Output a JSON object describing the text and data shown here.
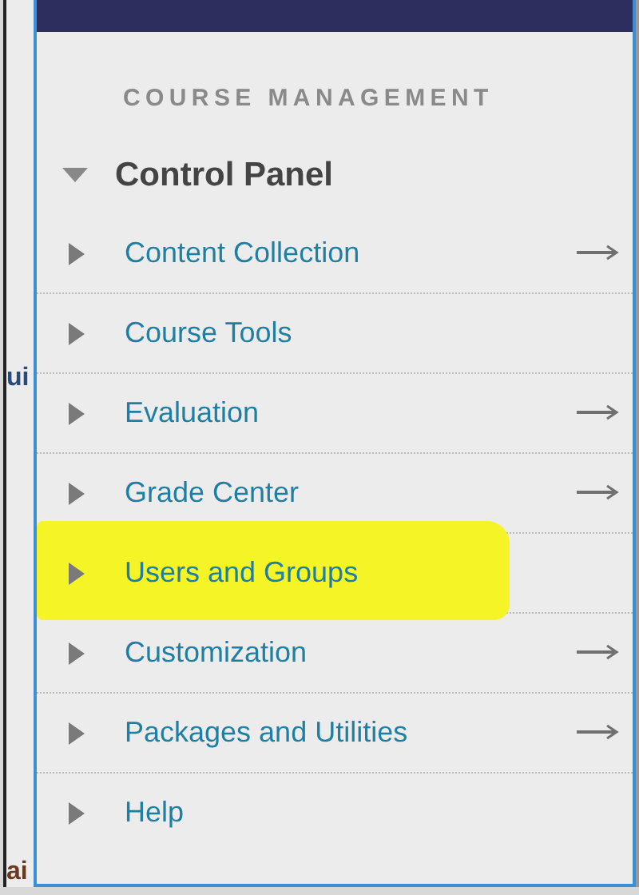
{
  "background_fragments": [
    {
      "text": "ui"
    },
    {
      "text": "ai"
    }
  ],
  "menu": {
    "heading": "COURSE MANAGEMENT",
    "section": {
      "title": "Control Panel",
      "expanded": true
    },
    "items": [
      {
        "label": "Content Collection",
        "has_arrow": true,
        "highlighted": false
      },
      {
        "label": "Course Tools",
        "has_arrow": false,
        "highlighted": false
      },
      {
        "label": "Evaluation",
        "has_arrow": true,
        "highlighted": false
      },
      {
        "label": "Grade Center",
        "has_arrow": true,
        "highlighted": false
      },
      {
        "label": "Users and Groups",
        "has_arrow": false,
        "highlighted": true
      },
      {
        "label": "Customization",
        "has_arrow": true,
        "highlighted": false
      },
      {
        "label": "Packages and Utilities",
        "has_arrow": true,
        "highlighted": false
      },
      {
        "label": "Help",
        "has_arrow": false,
        "highlighted": false
      }
    ]
  }
}
